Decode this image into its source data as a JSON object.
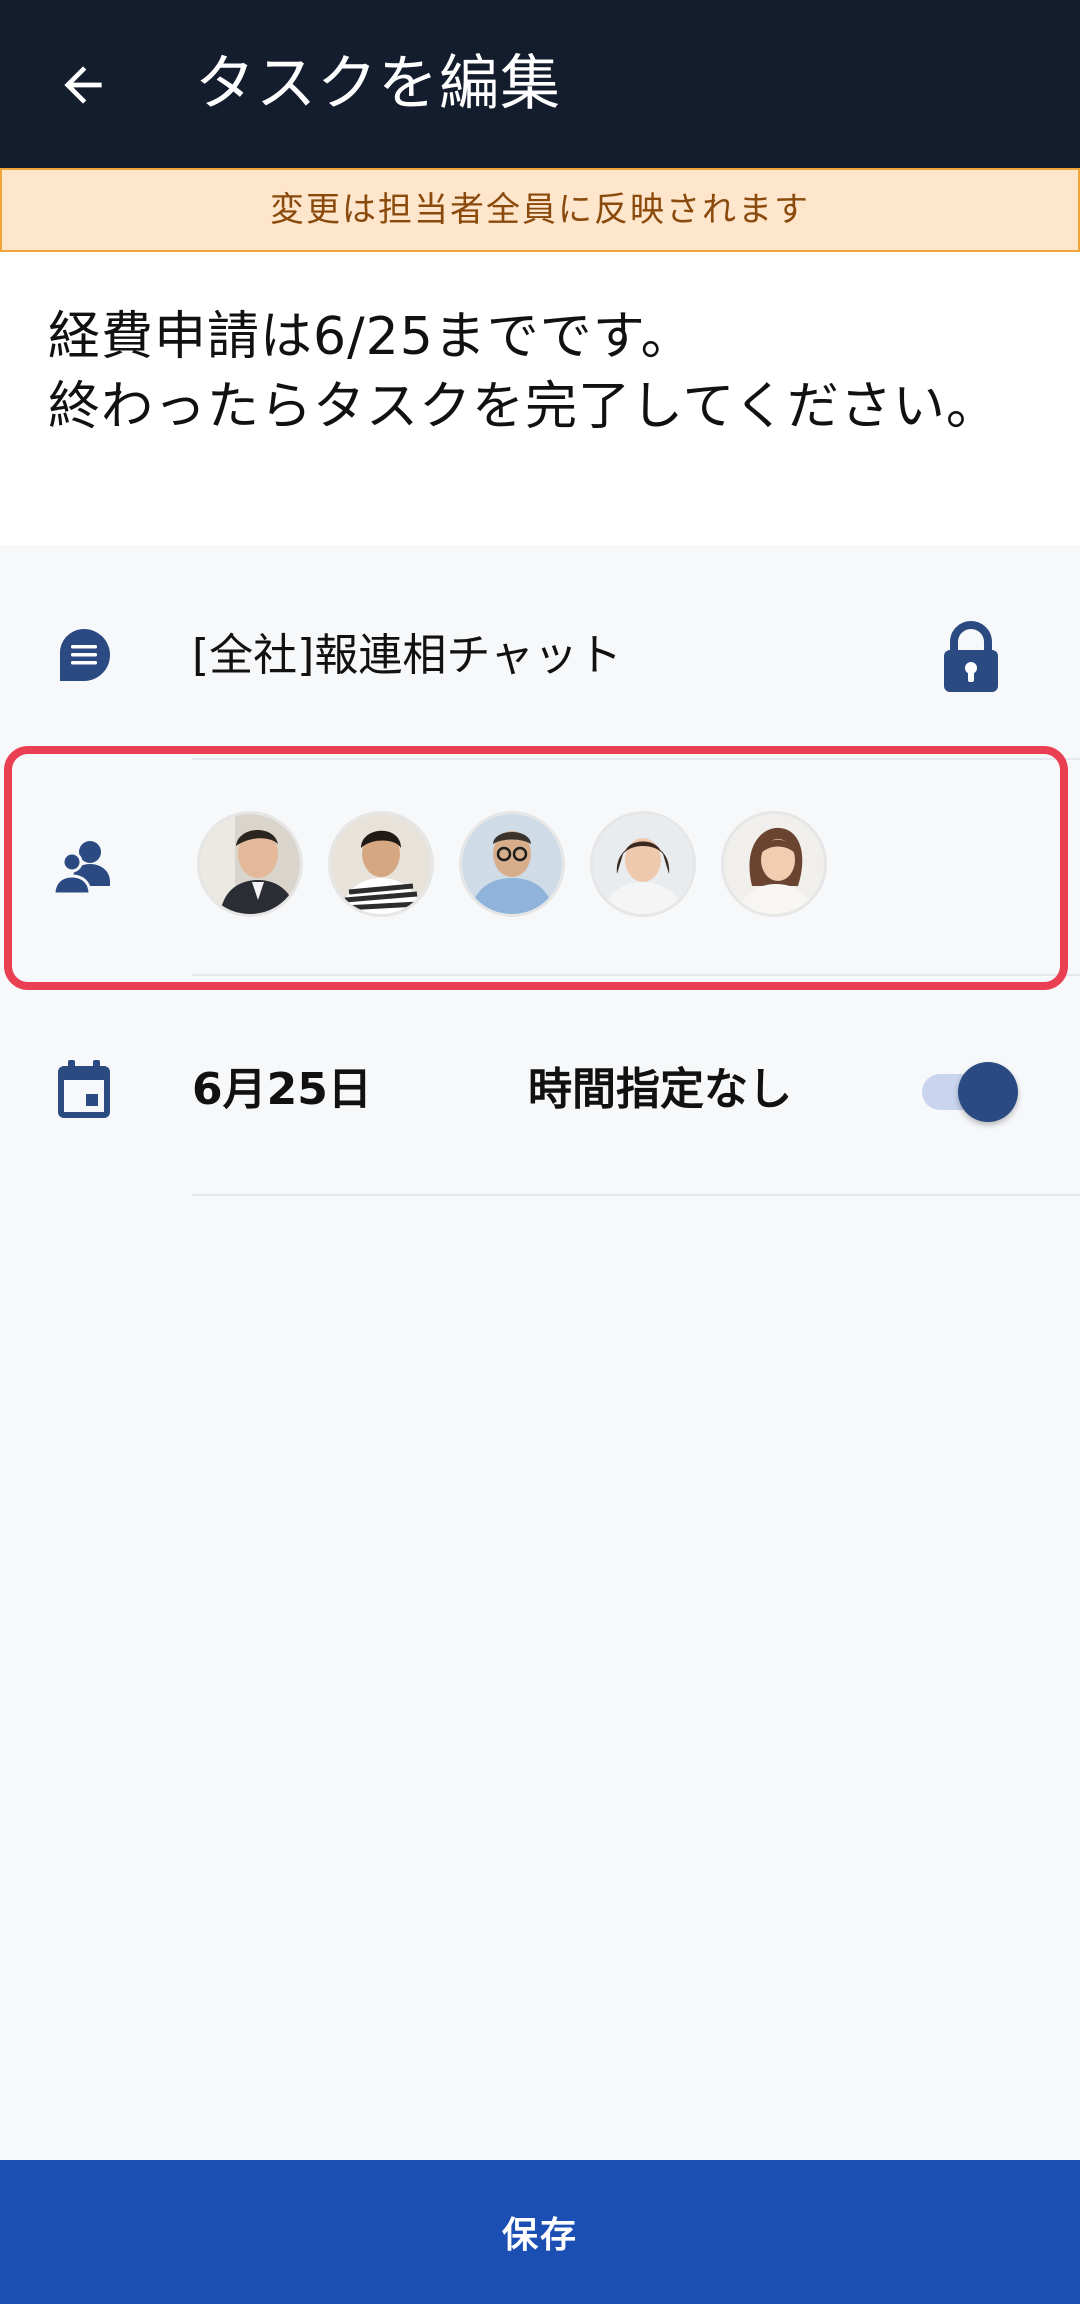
{
  "header": {
    "title": "タスクを編集",
    "back_icon": "arrow-left-icon"
  },
  "notice": {
    "text": "変更は担当者全員に反映されます"
  },
  "task": {
    "description": "経費申請は6/25までです。\n終わったらタスクを完了してください。"
  },
  "chat": {
    "icon": "chat-icon",
    "name": "[全社]報連相チャット",
    "lock_icon": "lock-icon"
  },
  "members": {
    "icon": "people-icon",
    "avatars": [
      {
        "name": "avatar-1"
      },
      {
        "name": "avatar-2"
      },
      {
        "name": "avatar-3"
      },
      {
        "name": "avatar-4"
      },
      {
        "name": "avatar-5"
      }
    ]
  },
  "due": {
    "icon": "calendar-icon",
    "date": "6月25日",
    "time_label": "時間指定なし",
    "time_toggle_on": true
  },
  "footer": {
    "save_label": "保存"
  },
  "colors": {
    "appbar": "#131d2d",
    "notice_bg": "#fee6cd",
    "notice_border": "#f2a33a",
    "highlight_border": "#ea3f52",
    "icon": "#2b4a82",
    "save_button": "#1b4fb4"
  }
}
